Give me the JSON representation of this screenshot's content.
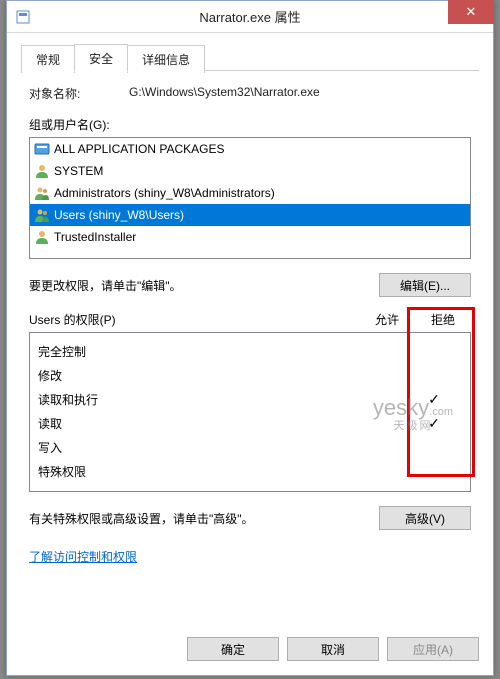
{
  "window": {
    "title": "Narrator.exe 属性",
    "close_glyph": "✕"
  },
  "tabs": {
    "general": "常规",
    "security": "安全",
    "details": "详细信息"
  },
  "object": {
    "label": "对象名称:",
    "value": "G:\\Windows\\System32\\Narrator.exe"
  },
  "groups": {
    "label": "组或用户名(G):",
    "items": [
      {
        "name": "ALL APPLICATION PACKAGES",
        "type": "package"
      },
      {
        "name": "SYSTEM",
        "type": "user"
      },
      {
        "name": "Administrators (shiny_W8\\Administrators)",
        "type": "group"
      },
      {
        "name": "Users (shiny_W8\\Users)",
        "type": "group",
        "selected": true
      },
      {
        "name": "TrustedInstaller",
        "type": "user"
      }
    ]
  },
  "edit": {
    "text": "要更改权限，请单击\"编辑\"。",
    "button": "编辑(E)..."
  },
  "permissions": {
    "header_name": "Users 的权限(P)",
    "header_allow": "允许",
    "header_deny": "拒绝",
    "rows": [
      {
        "name": "完全控制",
        "allow": "",
        "deny": ""
      },
      {
        "name": "修改",
        "allow": "",
        "deny": ""
      },
      {
        "name": "读取和执行",
        "allow": "",
        "deny": "✓"
      },
      {
        "name": "读取",
        "allow": "",
        "deny": "✓"
      },
      {
        "name": "写入",
        "allow": "",
        "deny": ""
      },
      {
        "name": "特殊权限",
        "allow": "",
        "deny": ""
      }
    ]
  },
  "advanced": {
    "text": "有关特殊权限或高级设置，请单击\"高级\"。",
    "button": "高级(V)"
  },
  "link": "了解访问控制和权限",
  "footer": {
    "ok": "确定",
    "cancel": "取消",
    "apply": "应用(A)"
  },
  "watermark": {
    "line1": "yesky",
    "suffix": ".com",
    "line2": "天极网"
  }
}
